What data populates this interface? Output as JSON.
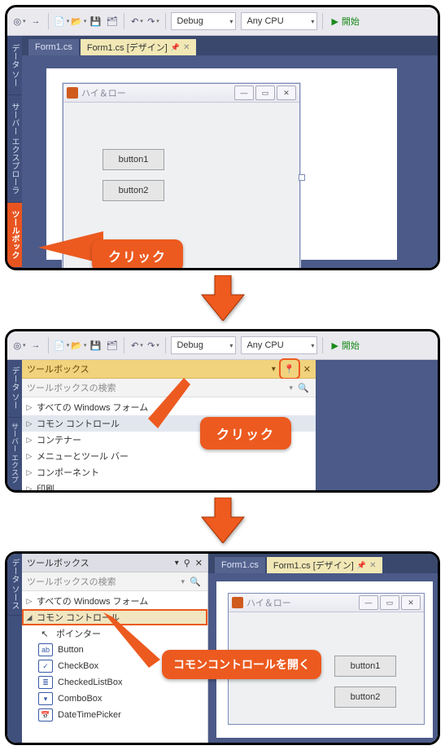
{
  "toolbar": {
    "config_label": "Debug",
    "platform_label": "Any CPU",
    "start_label": "開始"
  },
  "vtabs": {
    "data_source": "データ ソース",
    "server_explorer": "サーバー エクスプローラー",
    "toolbox": "ツールボックス"
  },
  "doctabs": {
    "code": "Form1.cs",
    "design": "Form1.cs [デザイン]"
  },
  "winform": {
    "title": "ハイ＆ロー",
    "button1": "button1",
    "button2": "button2"
  },
  "callouts": {
    "click": "クリック",
    "open_common": "コモンコントロールを開く"
  },
  "toolbox": {
    "title": "ツールボックス",
    "search_placeholder": "ツールボックスの検索",
    "groups": {
      "all_forms": "すべての Windows フォーム",
      "common": "コモン コントロール",
      "containers": "コンテナー",
      "menus": "メニューとツール バー",
      "components": "コンポーネント",
      "printing": "印刷"
    },
    "items": {
      "pointer": "ポインター",
      "button": "Button",
      "checkbox": "CheckBox",
      "checkedlistbox": "CheckedListBox",
      "combobox": "ComboBox",
      "datetimepicker": "DateTimePicker"
    }
  }
}
